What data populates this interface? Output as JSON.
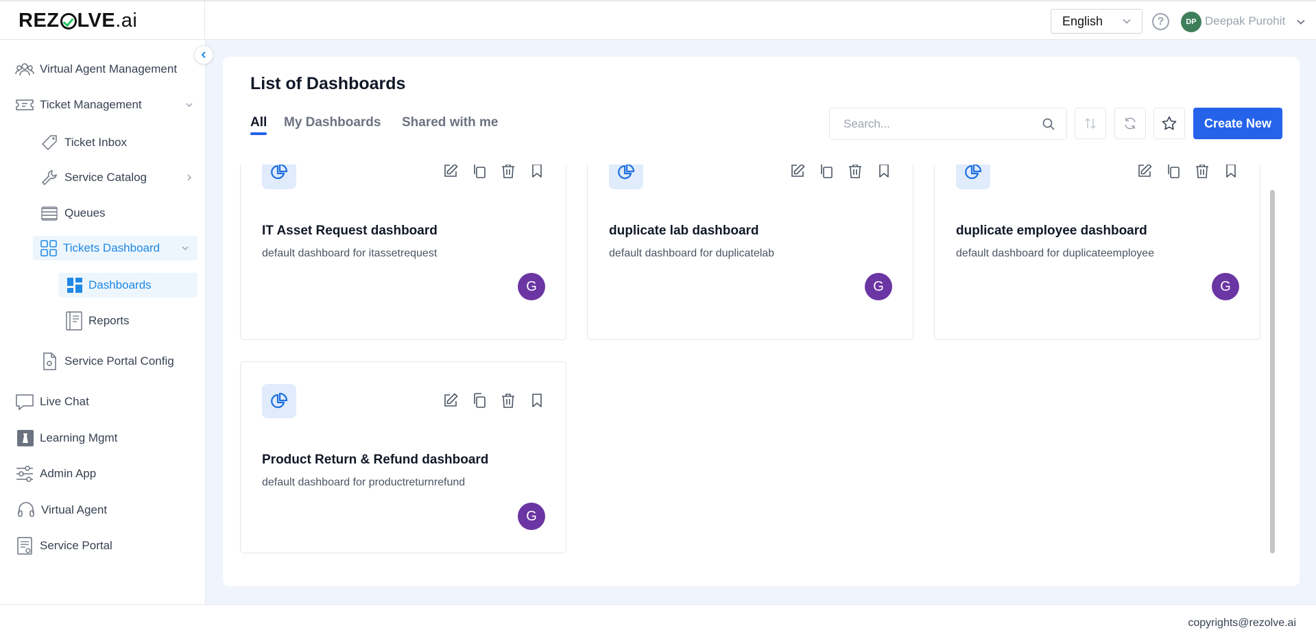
{
  "header": {
    "logo_left": "REZ",
    "logo_right": "LVE",
    "logo_suffix": ".ai",
    "language": "English",
    "user_initials": "DP",
    "user_name": "Deepak Purohit"
  },
  "sidebar": {
    "items": [
      {
        "label": "Virtual Agent Management",
        "icon": "users-group-icon"
      },
      {
        "label": "Ticket Management",
        "icon": "ticket-icon"
      },
      {
        "label": "Ticket Inbox",
        "icon": "tag-icon"
      },
      {
        "label": "Service Catalog",
        "icon": "wrench-icon"
      },
      {
        "label": "Queues",
        "icon": "queue-icon"
      },
      {
        "label": "Tickets Dashboard",
        "icon": "grid-icon"
      },
      {
        "label": "Dashboards",
        "icon": "dashboard-icon"
      },
      {
        "label": "Reports",
        "icon": "report-icon"
      },
      {
        "label": "Service Portal Config",
        "icon": "file-gear-icon"
      },
      {
        "label": "Live Chat",
        "icon": "chat-icon"
      },
      {
        "label": "Learning Mgmt",
        "icon": "learning-icon"
      },
      {
        "label": "Admin App",
        "icon": "sliders-icon"
      },
      {
        "label": "Virtual Agent",
        "icon": "headset-icon"
      },
      {
        "label": "Service Portal",
        "icon": "portal-icon"
      }
    ]
  },
  "main": {
    "title": "List of Dashboards",
    "tabs": [
      {
        "label": "All",
        "active": true
      },
      {
        "label": "My Dashboards",
        "active": false
      },
      {
        "label": "Shared with me",
        "active": false
      }
    ],
    "search_placeholder": "Search...",
    "create_label": "Create New",
    "cards": [
      {
        "title": "IT Asset Request dashboard",
        "description": "default dashboard for itassetrequest",
        "avatar": "G"
      },
      {
        "title": "duplicate lab dashboard",
        "description": "default dashboard for duplicatelab",
        "avatar": "G"
      },
      {
        "title": "duplicate employee dashboard",
        "description": "default dashboard for duplicateemployee",
        "avatar": "G"
      },
      {
        "title": "Product Return & Refund dashboard",
        "description": "default dashboard for productreturnrefund",
        "avatar": "G"
      }
    ]
  },
  "footer": {
    "copyright": "copyrights@rezolve.ai"
  },
  "colors": {
    "accent": "#2563eb",
    "sidebar_active": "#1e88e5",
    "avatar_purple": "#6b35a3",
    "user_avatar": "#3f7e5a"
  }
}
